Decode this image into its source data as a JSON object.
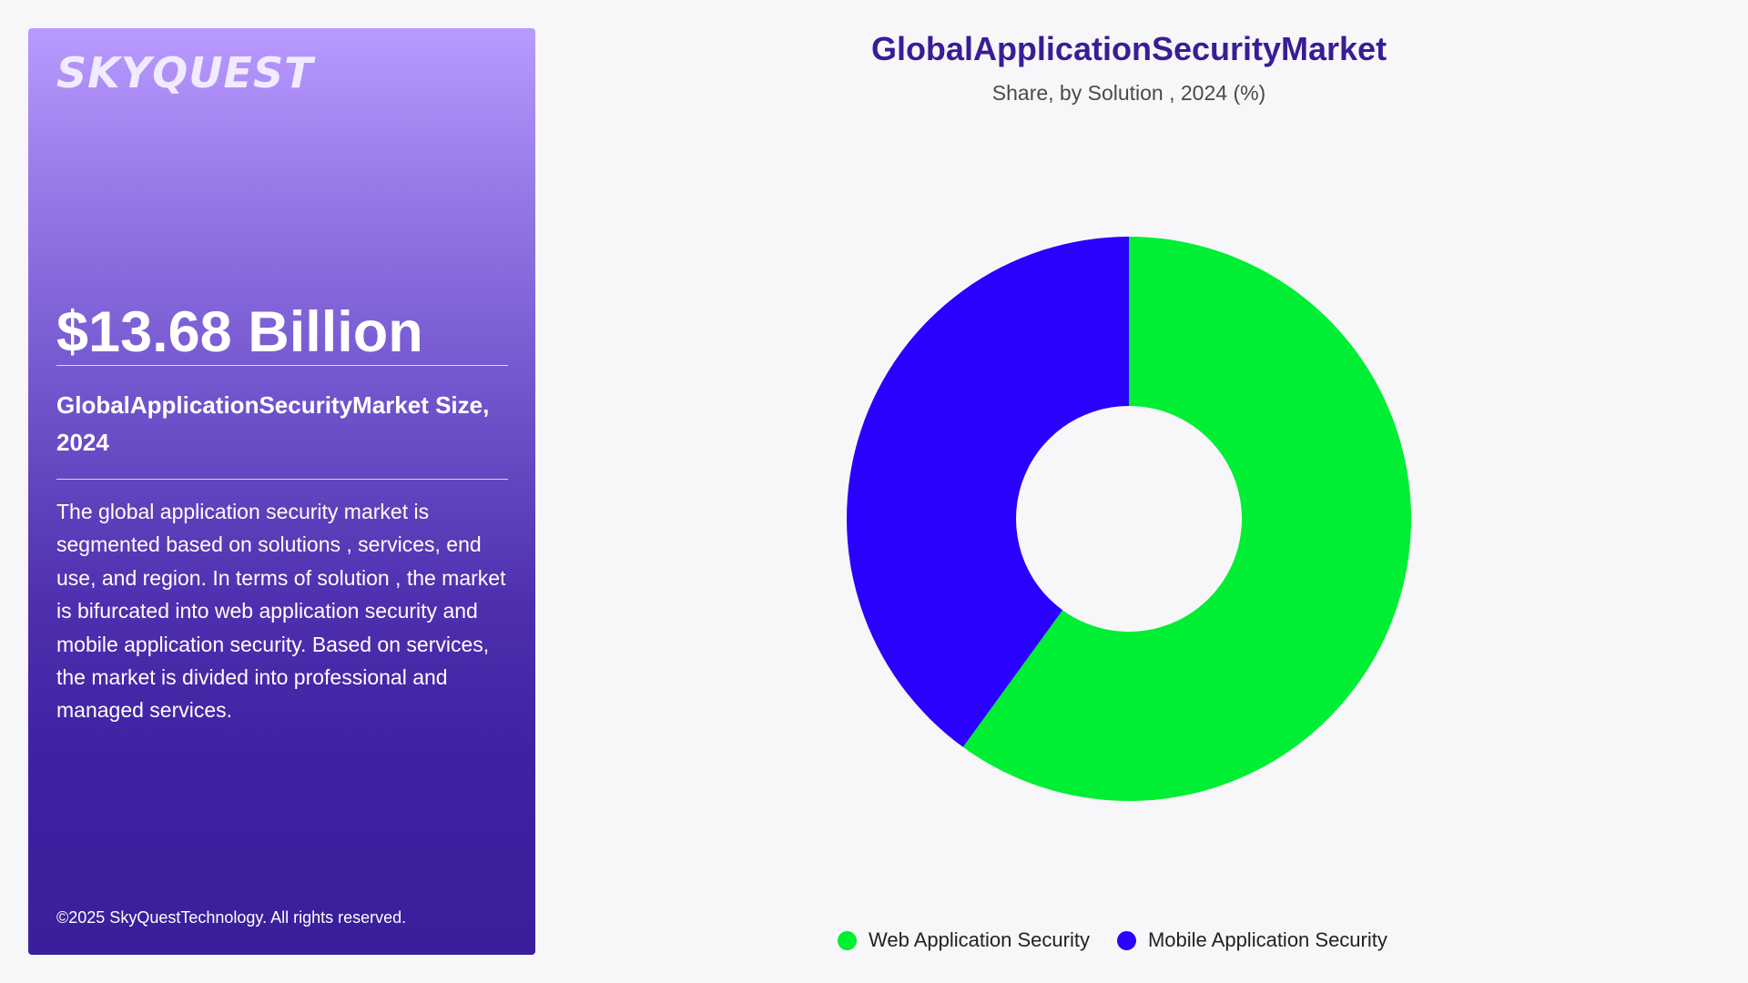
{
  "panel": {
    "logo": "SKYQUEST",
    "market_value": "$13.68 Billion",
    "market_label": "GlobalApplicationSecurityMarket Size, 2024",
    "description": "The global application security market is segmented based on solutions , services, end use, and region. In terms of solution , the market is bifurcated into web application security and mobile application security. Based on services, the market is divided into professional and managed services.",
    "copyright": "©2025 SkyQuestTechnology. All rights reserved.",
    "gradient_top": "#b99aff",
    "gradient_bottom": "#3a1e9b"
  },
  "chart_data": {
    "type": "pie",
    "donut": true,
    "title": "GlobalApplicationSecurityMarket",
    "subtitle": "Share, by Solution , 2024 (%)",
    "categories": [
      "Web Application Security",
      "Mobile Application Security"
    ],
    "values": [
      60,
      40
    ],
    "colors": [
      "#00ee33",
      "#2a00ff"
    ],
    "start_angle_deg": 0,
    "direction": "clockwise",
    "legend_position": "bottom"
  }
}
